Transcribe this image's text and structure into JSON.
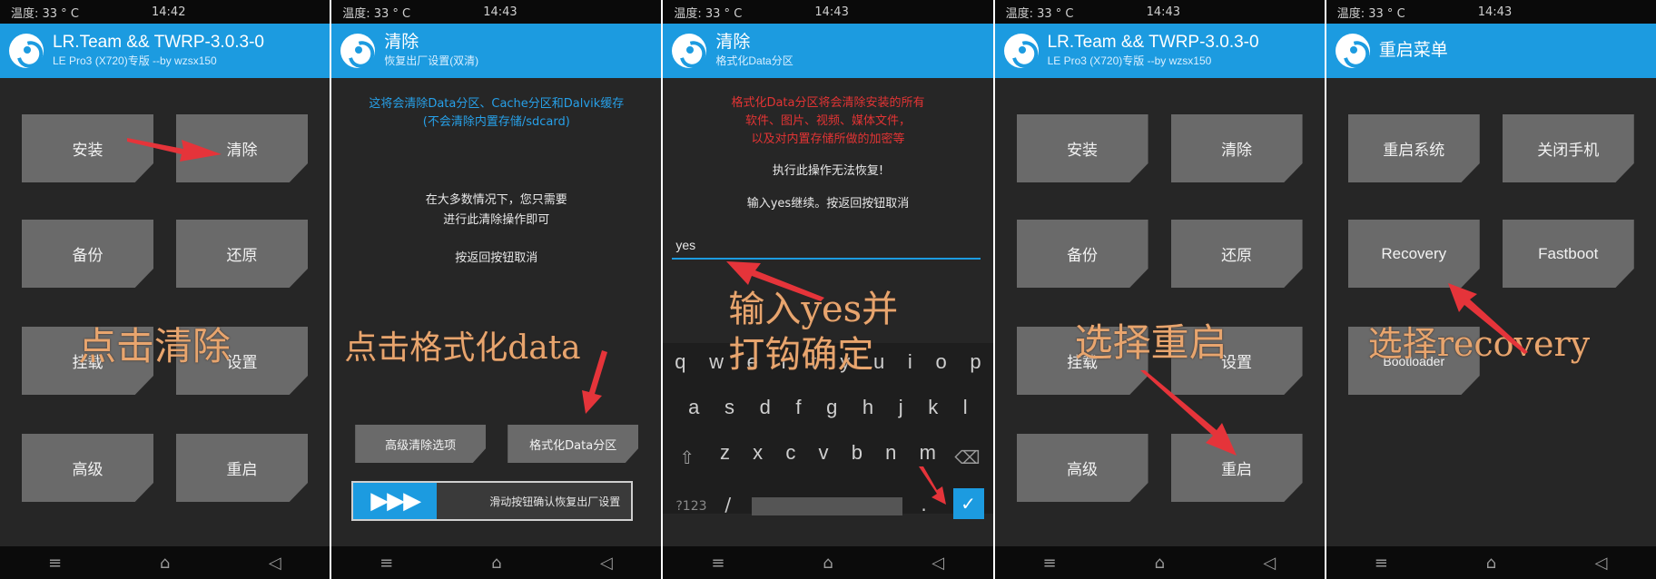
{
  "panels": [
    {
      "status": {
        "temp": "温度: 33 ° C",
        "time": "14:42"
      },
      "header": {
        "title": "LR.Team && TWRP-3.0.3-0",
        "subtitle": "LE Pro3 (X720)专版 --by wzsx150"
      },
      "tiles": [
        "安装",
        "清除",
        "备份",
        "还原",
        "挂载",
        "设置",
        "高级",
        "重启"
      ],
      "annotation": "点击清除"
    },
    {
      "status": {
        "temp": "温度: 33 ° C",
        "time": "14:43"
      },
      "header": {
        "title": "清除",
        "subtitle": "恢复出厂设置(双清)"
      },
      "info_line1": "这将会清除Data分区、Cache分区和Dalvik缓存",
      "info_line2": "(不会清除内置存储/sdcard)",
      "note_line1": "在大多数情况下，您只需要",
      "note_line2": "进行此清除操作即可",
      "note_line3": "按返回按钮取消",
      "buttons": [
        "高级清除选项",
        "格式化Data分区"
      ],
      "slider_label": "滑动按钮确认恢复出厂设置",
      "annotation": "点击格式化data"
    },
    {
      "status": {
        "temp": "温度: 33 ° C",
        "time": "14:43"
      },
      "header": {
        "title": "清除",
        "subtitle": "格式化Data分区"
      },
      "warning_line1": "格式化Data分区将会清除安装的所有",
      "warning_line2": "软件、图片、视频、媒体文件，",
      "warning_line3": "以及对内置存储所做的加密等",
      "line1": "执行此操作无法恢复!",
      "line2": "输入yes继续。按返回按钮取消",
      "input_value": "yes",
      "keyboard": {
        "row1": [
          "q",
          "w",
          "e",
          "r",
          "t",
          "y",
          "u",
          "i",
          "o",
          "p"
        ],
        "row2": [
          "a",
          "s",
          "d",
          "f",
          "g",
          "h",
          "j",
          "k",
          "l"
        ],
        "row3": [
          "z",
          "x",
          "c",
          "v",
          "b",
          "n",
          "m"
        ],
        "symbols_key": "?123",
        "slash_key": "/",
        "period_key": ".",
        "enter_key": "✓"
      },
      "annotation_line1": "输入yes并",
      "annotation_line2": "打钩确定"
    },
    {
      "status": {
        "temp": "温度: 33 ° C",
        "time": "14:43"
      },
      "header": {
        "title": "LR.Team && TWRP-3.0.3-0",
        "subtitle": "LE Pro3 (X720)专版 --by wzsx150"
      },
      "tiles": [
        "安装",
        "清除",
        "备份",
        "还原",
        "挂载",
        "设置",
        "高级",
        "重启"
      ],
      "annotation": "选择重启"
    },
    {
      "status": {
        "temp": "温度: 33 ° C",
        "time": "14:43"
      },
      "header": {
        "title": "重启菜单",
        "subtitle": ""
      },
      "tiles": [
        "重启系统",
        "关闭手机",
        "Recovery",
        "Fastboot",
        "Bootloader"
      ],
      "annotation": "选择recovery"
    }
  ],
  "navbar": {
    "menu": "≡",
    "home": "⌂",
    "back": "◁"
  },
  "colors": {
    "accent": "#1c9be0",
    "tile": "#6a6a6a",
    "background": "#262626",
    "annotation": "#e8a56e",
    "arrow": "#e5343a",
    "warning": "#e23434"
  }
}
